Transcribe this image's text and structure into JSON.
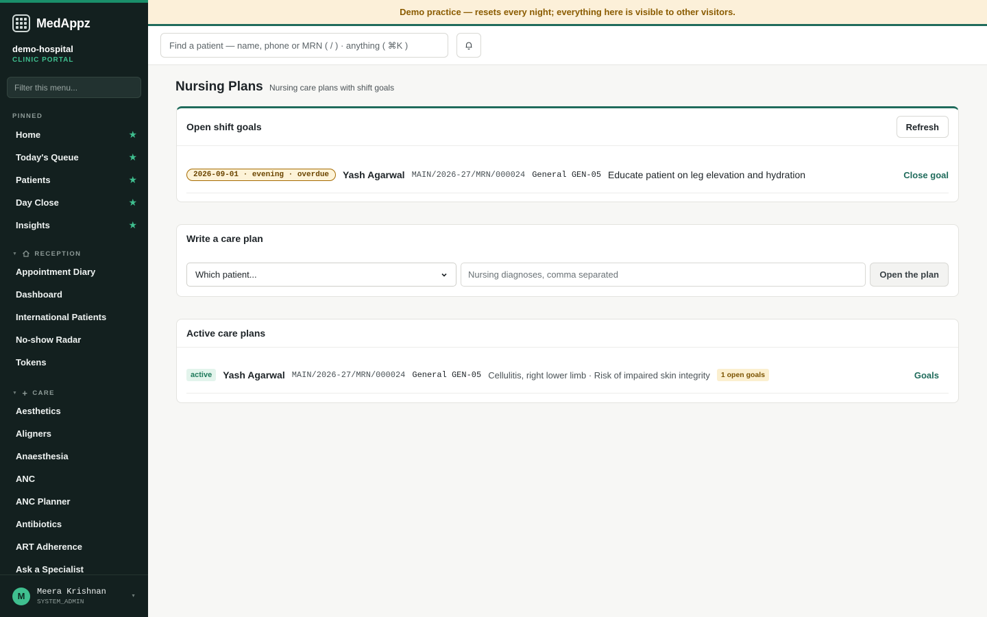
{
  "app": {
    "brand": "MedAppz",
    "org_name": "demo-hospital",
    "org_sub": "CLINIC PORTAL",
    "menu_filter_placeholder": "Filter this menu..."
  },
  "sidebar": {
    "pinned_label": "PINNED",
    "pinned": [
      {
        "label": "Home"
      },
      {
        "label": "Today's Queue"
      },
      {
        "label": "Patients"
      },
      {
        "label": "Day Close"
      },
      {
        "label": "Insights"
      }
    ],
    "reception_label": "RECEPTION",
    "reception": [
      {
        "label": "Appointment Diary"
      },
      {
        "label": "Dashboard"
      },
      {
        "label": "International Patients"
      },
      {
        "label": "No-show Radar"
      },
      {
        "label": "Tokens"
      }
    ],
    "care_label": "CARE",
    "care": [
      {
        "label": "Aesthetics"
      },
      {
        "label": "Aligners"
      },
      {
        "label": "Anaesthesia"
      },
      {
        "label": "ANC"
      },
      {
        "label": "ANC Planner"
      },
      {
        "label": "Antibiotics"
      },
      {
        "label": "ART Adherence"
      },
      {
        "label": "Ask a Specialist"
      }
    ]
  },
  "user": {
    "initial": "M",
    "name": "Meera Krishnan",
    "role": "SYSTEM_ADMIN"
  },
  "banner": {
    "text": "Demo practice — resets every night; everything here is visible to other visitors."
  },
  "search": {
    "placeholder": "Find a patient — name, phone or MRN ( / ) · anything ( ⌘K )"
  },
  "page": {
    "title": "Nursing Plans",
    "subtitle": "Nursing care plans with shift goals"
  },
  "open_goals": {
    "title": "Open shift goals",
    "refresh_label": "Refresh",
    "rows": [
      {
        "status": "2026-09-01 · evening · overdue",
        "patient": "Yash Agarwal",
        "mrn": "MAIN/2026-27/MRN/000024",
        "ward": "General GEN-05",
        "goal": "Educate patient on leg elevation and hydration",
        "action": "Close goal"
      }
    ]
  },
  "write_plan": {
    "title": "Write a care plan",
    "patient_select": "Which patient...",
    "diagnoses_placeholder": "Nursing diagnoses, comma separated",
    "open_label": "Open the plan"
  },
  "active_plans": {
    "title": "Active care plans",
    "rows": [
      {
        "status": "active",
        "patient": "Yash Agarwal",
        "mrn": "MAIN/2026-27/MRN/000024",
        "ward": "General GEN-05",
        "diagnoses": "Cellulitis, right lower limb · Risk of impaired skin integrity",
        "open_goals": "1 open goals",
        "action": "Goals"
      }
    ]
  },
  "colors": {
    "sidebar_bg": "#13201f",
    "accent": "#1f6b5b",
    "star": "#3fbf8f",
    "banner_bg": "#fcf0d9",
    "banner_text": "#8a5b00"
  }
}
